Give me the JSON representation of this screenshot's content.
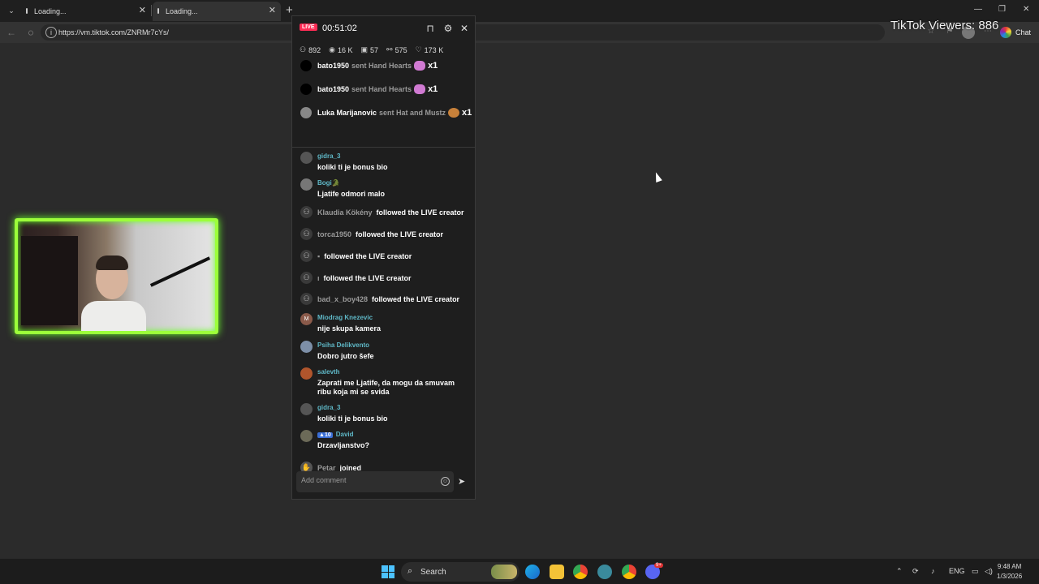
{
  "browser": {
    "tabs": [
      {
        "title": "Loading..."
      },
      {
        "title": "Loading..."
      }
    ],
    "url": "https://vm.tiktok.com/ZNRMr7cYs/",
    "chat_label": "Chat"
  },
  "overlay": {
    "viewers_text": "TikTok Viewers: 886"
  },
  "live_panel": {
    "live_label": "LIVE",
    "timer": "00:51:02",
    "stats": {
      "viewers": "892",
      "views": "16 K",
      "gifts": "57",
      "shares": "575",
      "likes": "173 K"
    },
    "gifts": [
      {
        "user": "bato1950",
        "action": "sent Hand Hearts",
        "count": "x1"
      },
      {
        "user": "bato1950",
        "action": "sent Hand Hearts",
        "count": "x1"
      },
      {
        "user": "Luka Marijanovic",
        "action": "sent Hat and Mustz",
        "count": "x1"
      }
    ],
    "messages": [
      {
        "user": "gidra_3",
        "text": "koliki ti je bonus bio"
      },
      {
        "user": "Bogi🐊",
        "text": "Ljatife odmori malo"
      },
      {
        "user": "Miodrag Knezevic",
        "text": "nije skupa kamera"
      },
      {
        "user": "Psiha Delikvento",
        "text": "Dobro jutro šefe"
      },
      {
        "user": "salevth",
        "text": "Zaprati me Ljatife, da mogu da smuvam ribu koja mi se svida"
      },
      {
        "user": "gidra_3",
        "text": "koliki ti je bonus bio"
      },
      {
        "user": "David",
        "text": "Drzavljanstvo?",
        "level": "10"
      }
    ],
    "follows": [
      {
        "user": "Klaudia Kökény",
        "action": "followed the LIVE creator"
      },
      {
        "user": "torca1950",
        "action": "followed the LIVE creator"
      },
      {
        "user": "",
        "action": "followed the LIVE creator"
      },
      {
        "user": "",
        "action": "followed the LIVE creator"
      },
      {
        "user": "bad_x_boy428",
        "action": "followed the LIVE creator"
      }
    ],
    "join": {
      "user": "Petar",
      "action": "joined"
    },
    "comment_placeholder": "Add comment"
  },
  "taskbar": {
    "search_label": "Search",
    "language": "ENG",
    "time": "9:48 AM",
    "date": "1/3/2026",
    "notif_count": "9+"
  }
}
